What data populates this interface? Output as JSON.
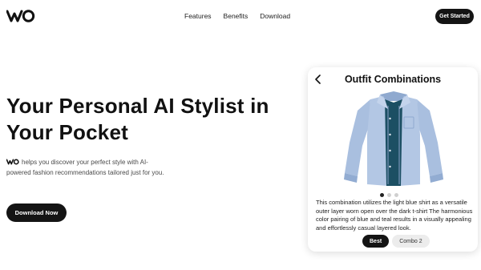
{
  "nav": {
    "links": [
      "Features",
      "Benefits",
      "Download"
    ],
    "cta_label": "Get Started"
  },
  "hero": {
    "title": "Your Personal AI Stylist in Your Pocket",
    "description": "helps you discover your perfect style with AI-powered fashion recommendations tailored just for you.",
    "download_label": "Download Now"
  },
  "card": {
    "title": "Outfit Combinations",
    "description": "This combination utilizes the light blue shirt as a versatile outer layer worn open over the dark t-shirt The harmonious color pairing of blue and teal results in a visually appealing and effortlessly casual layered look.",
    "carousel": {
      "total": 3,
      "active_index": 0
    },
    "tabs": [
      {
        "label": "Best",
        "active": true
      },
      {
        "label": "Combo 2",
        "active": false
      }
    ]
  },
  "colors": {
    "dark": "#141414",
    "shirt_blue": "#a9bfdf",
    "tshirt_teal": "#1c4f63"
  },
  "icons": {
    "logo": "wo-logo",
    "back": "chevron-left-icon"
  }
}
